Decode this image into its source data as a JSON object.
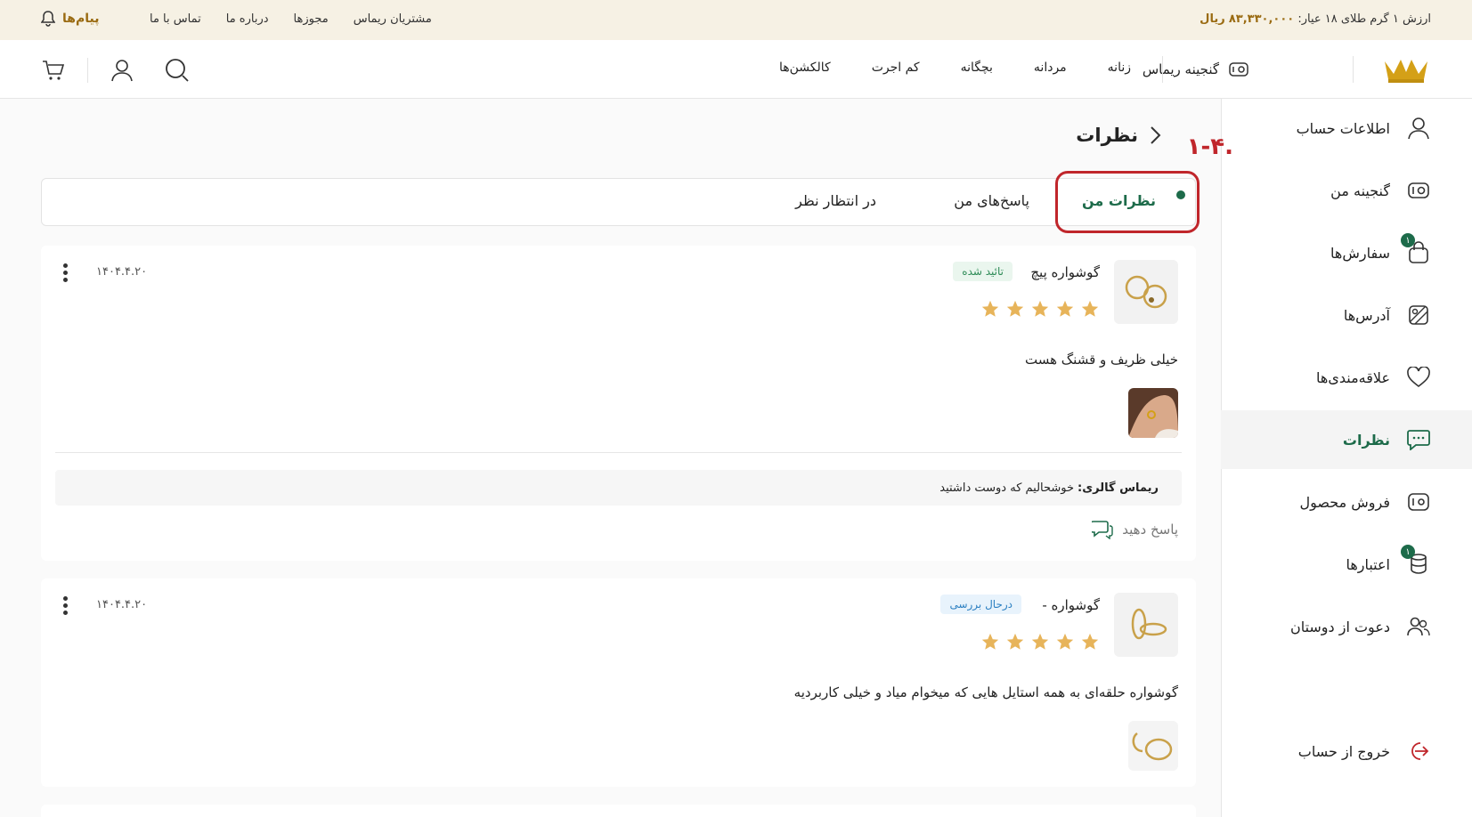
{
  "topbar": {
    "gold_price_label": "ارزش ۱ گرم طلای ۱۸ عیار:",
    "gold_price_value": "۸۳,۳۳۰,۰۰۰",
    "gold_price_unit": "ریال",
    "links": [
      "مشتریان ریماس",
      "مجوزها",
      "درباره ما",
      "تماس با ما"
    ],
    "messages_label": "پیام‌ها"
  },
  "header": {
    "treasure_label": "گنجینه ریماس",
    "nav": [
      "زنانه",
      "مردانه",
      "بچگانه",
      "کم اجرت",
      "کالکشن‌ها"
    ],
    "accent_color": "#d4a017"
  },
  "sidebar": {
    "items": [
      {
        "label": "اطلاعات حساب",
        "icon": "user-icon"
      },
      {
        "label": "گنجینه من",
        "icon": "treasure-icon"
      },
      {
        "label": "سفارش‌ها",
        "icon": "bag-icon",
        "badge": "۱"
      },
      {
        "label": "آدرس‌ها",
        "icon": "map-icon"
      },
      {
        "label": "علاقه‌مندی‌ها",
        "icon": "heart-icon"
      },
      {
        "label": "نظرات",
        "icon": "comments-icon",
        "active": true
      },
      {
        "label": "فروش محصول",
        "icon": "sell-icon"
      },
      {
        "label": "اعتبارها",
        "icon": "coins-icon",
        "badge": "۱"
      },
      {
        "label": "دعوت از دوستان",
        "icon": "users-icon"
      }
    ],
    "logout_label": "خروج از حساب"
  },
  "main": {
    "title": "نظرات",
    "annotation": "۱-۴.",
    "tabs": [
      "نظرات من",
      "پاسخ‌های من",
      "در انتظار نظر"
    ],
    "active_tab": 0,
    "reviews": [
      {
        "product": "گوشواره پیچ",
        "status": "تائید شده",
        "rating": 5,
        "date": "۱۴۰۴.۴.۲۰",
        "comment": "خیلی ظریف و قشنگ هست",
        "reply_author": "ریماس گالری:",
        "reply_text": "خوشحالیم که دوست داشتید",
        "reply_button": "پاسخ دهید"
      },
      {
        "product": "گوشواره -",
        "status": "درحال بررسی",
        "rating": 5,
        "date": "۱۴۰۴.۴.۲۰",
        "comment": "گوشواره حلقه‌ای به همه استایل هایی که میخوام میاد و خیلی کاربردیه"
      }
    ]
  },
  "colors": {
    "primary": "#1d6b4a",
    "gold": "#9a6b12",
    "star": "#e7b45a",
    "annotation": "#c0262b"
  }
}
